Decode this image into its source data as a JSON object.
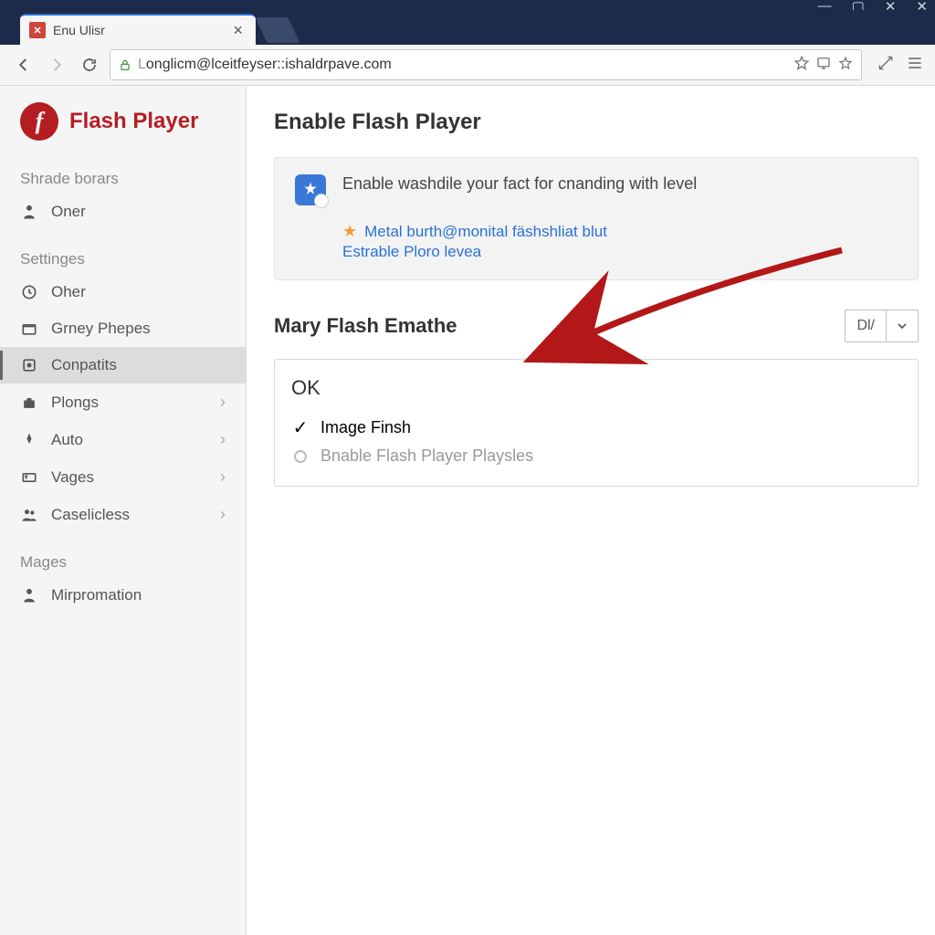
{
  "window": {
    "minimize": "—",
    "maximize": "▢",
    "close": "✕",
    "close2": "✕"
  },
  "tab": {
    "title": "Enu Ulisr",
    "icon_glyph": "✕"
  },
  "addressbar": {
    "url_prefix": "L",
    "url": "onglicm@lceitfeyser::ishaldrpave.com"
  },
  "sidebar": {
    "brand": "Flash Player",
    "section1": "Shrade borars",
    "items1": [
      {
        "label": "Oner",
        "icon": "person"
      }
    ],
    "section2": "Settinges",
    "items2": [
      {
        "label": "Oher",
        "icon": "clock",
        "chev": false
      },
      {
        "label": "Grney Phepes",
        "icon": "folder-open",
        "chev": false
      },
      {
        "label": "Conpatits",
        "icon": "plugin",
        "chev": false,
        "active": true
      },
      {
        "label": "Plongs",
        "icon": "briefcase",
        "chev": true
      },
      {
        "label": "Auto",
        "icon": "rocket",
        "chev": true
      },
      {
        "label": "Vages",
        "icon": "textbox",
        "chev": true
      },
      {
        "label": "Caselicless",
        "icon": "people",
        "chev": true
      }
    ],
    "section3": "Mages",
    "items3": [
      {
        "label": "Mirpromation",
        "icon": "person"
      }
    ]
  },
  "main": {
    "title": "Enable Flash Player",
    "info_text": "Enable washdile your fact for cnanding with level",
    "link1": "Metal burth@monital fäshshliat blut",
    "link2": "Estrable Ploro levea",
    "section_title": "Mary Flash Emathe",
    "dropdown_value": "Dl/",
    "ok_label": "OK",
    "opt1": "Image Finsh",
    "opt2": "Bnable Flash Player Playsles"
  }
}
